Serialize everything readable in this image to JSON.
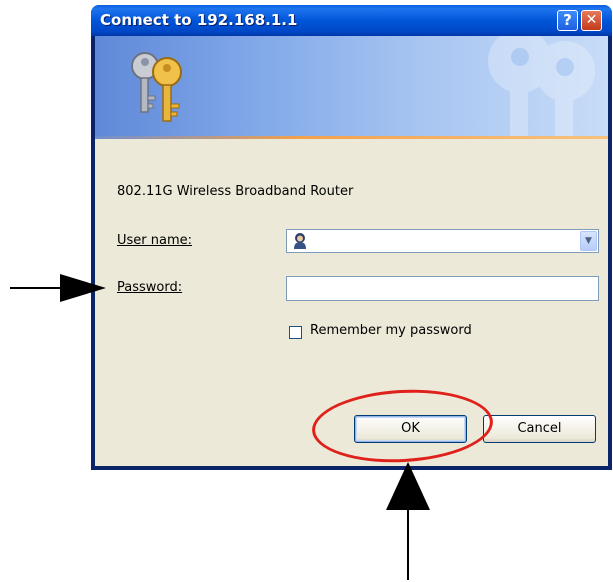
{
  "dialog": {
    "title": "Connect to 192.168.1.1",
    "help_button": "?",
    "close_button": "✕",
    "device_label": "802.11G Wireless Broadband Router",
    "username": {
      "label": "User name:",
      "value": ""
    },
    "password": {
      "label": "Password:",
      "value": ""
    },
    "remember": {
      "label": "Remember my password",
      "checked": false
    },
    "ok_label": "OK",
    "cancel_label": "Cancel"
  },
  "icons": {
    "banner": "keys-icon",
    "watermark": "keys-watermark-icon",
    "user": "user-icon",
    "dropdown": "chevron-down-icon"
  },
  "annotations": {
    "color": "#e0201b",
    "arrow_color": "#000000"
  }
}
